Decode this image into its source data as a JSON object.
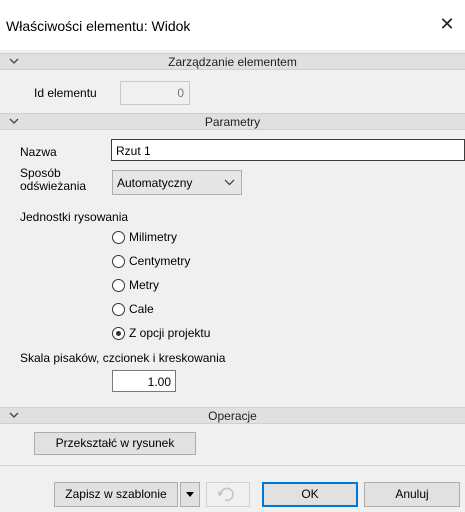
{
  "window": {
    "title": "Właściwości elementu: Widok",
    "close_glyph": "✕"
  },
  "sections": {
    "management": "Zarządzanie elementem",
    "parameters": "Parametry",
    "operations": "Operacje"
  },
  "fields": {
    "element_id_label": "Id elementu",
    "element_id_value": "0",
    "name_label": "Nazwa",
    "name_value": "Rzut 1",
    "refresh_label_line1": "Sposób",
    "refresh_label_line2": "odświeżania",
    "refresh_value": "Automatyczny",
    "units_label": "Jednostki rysowania",
    "scale_label": "Skala pisaków, czcionek i kreskowania",
    "scale_value": "1.00"
  },
  "units_options": [
    {
      "label": "Milimetry",
      "selected": false
    },
    {
      "label": "Centymetry",
      "selected": false
    },
    {
      "label": "Metry",
      "selected": false
    },
    {
      "label": "Cale",
      "selected": false
    },
    {
      "label": "Z opcji projektu",
      "selected": true
    }
  ],
  "buttons": {
    "convert": "Przekształć w rysunek",
    "save_template": "Zapisz w szablonie",
    "ok": "OK",
    "cancel": "Anuluj"
  },
  "icons": {
    "section_toggle": "chevron-down-icon",
    "close": "close-icon",
    "dropdown": "chevron-down-icon",
    "undo": "undo-icon"
  },
  "colors": {
    "accent": "#0078d7",
    "section_bg": "#e0e0e0",
    "window_bg": "#f0f0f0"
  }
}
